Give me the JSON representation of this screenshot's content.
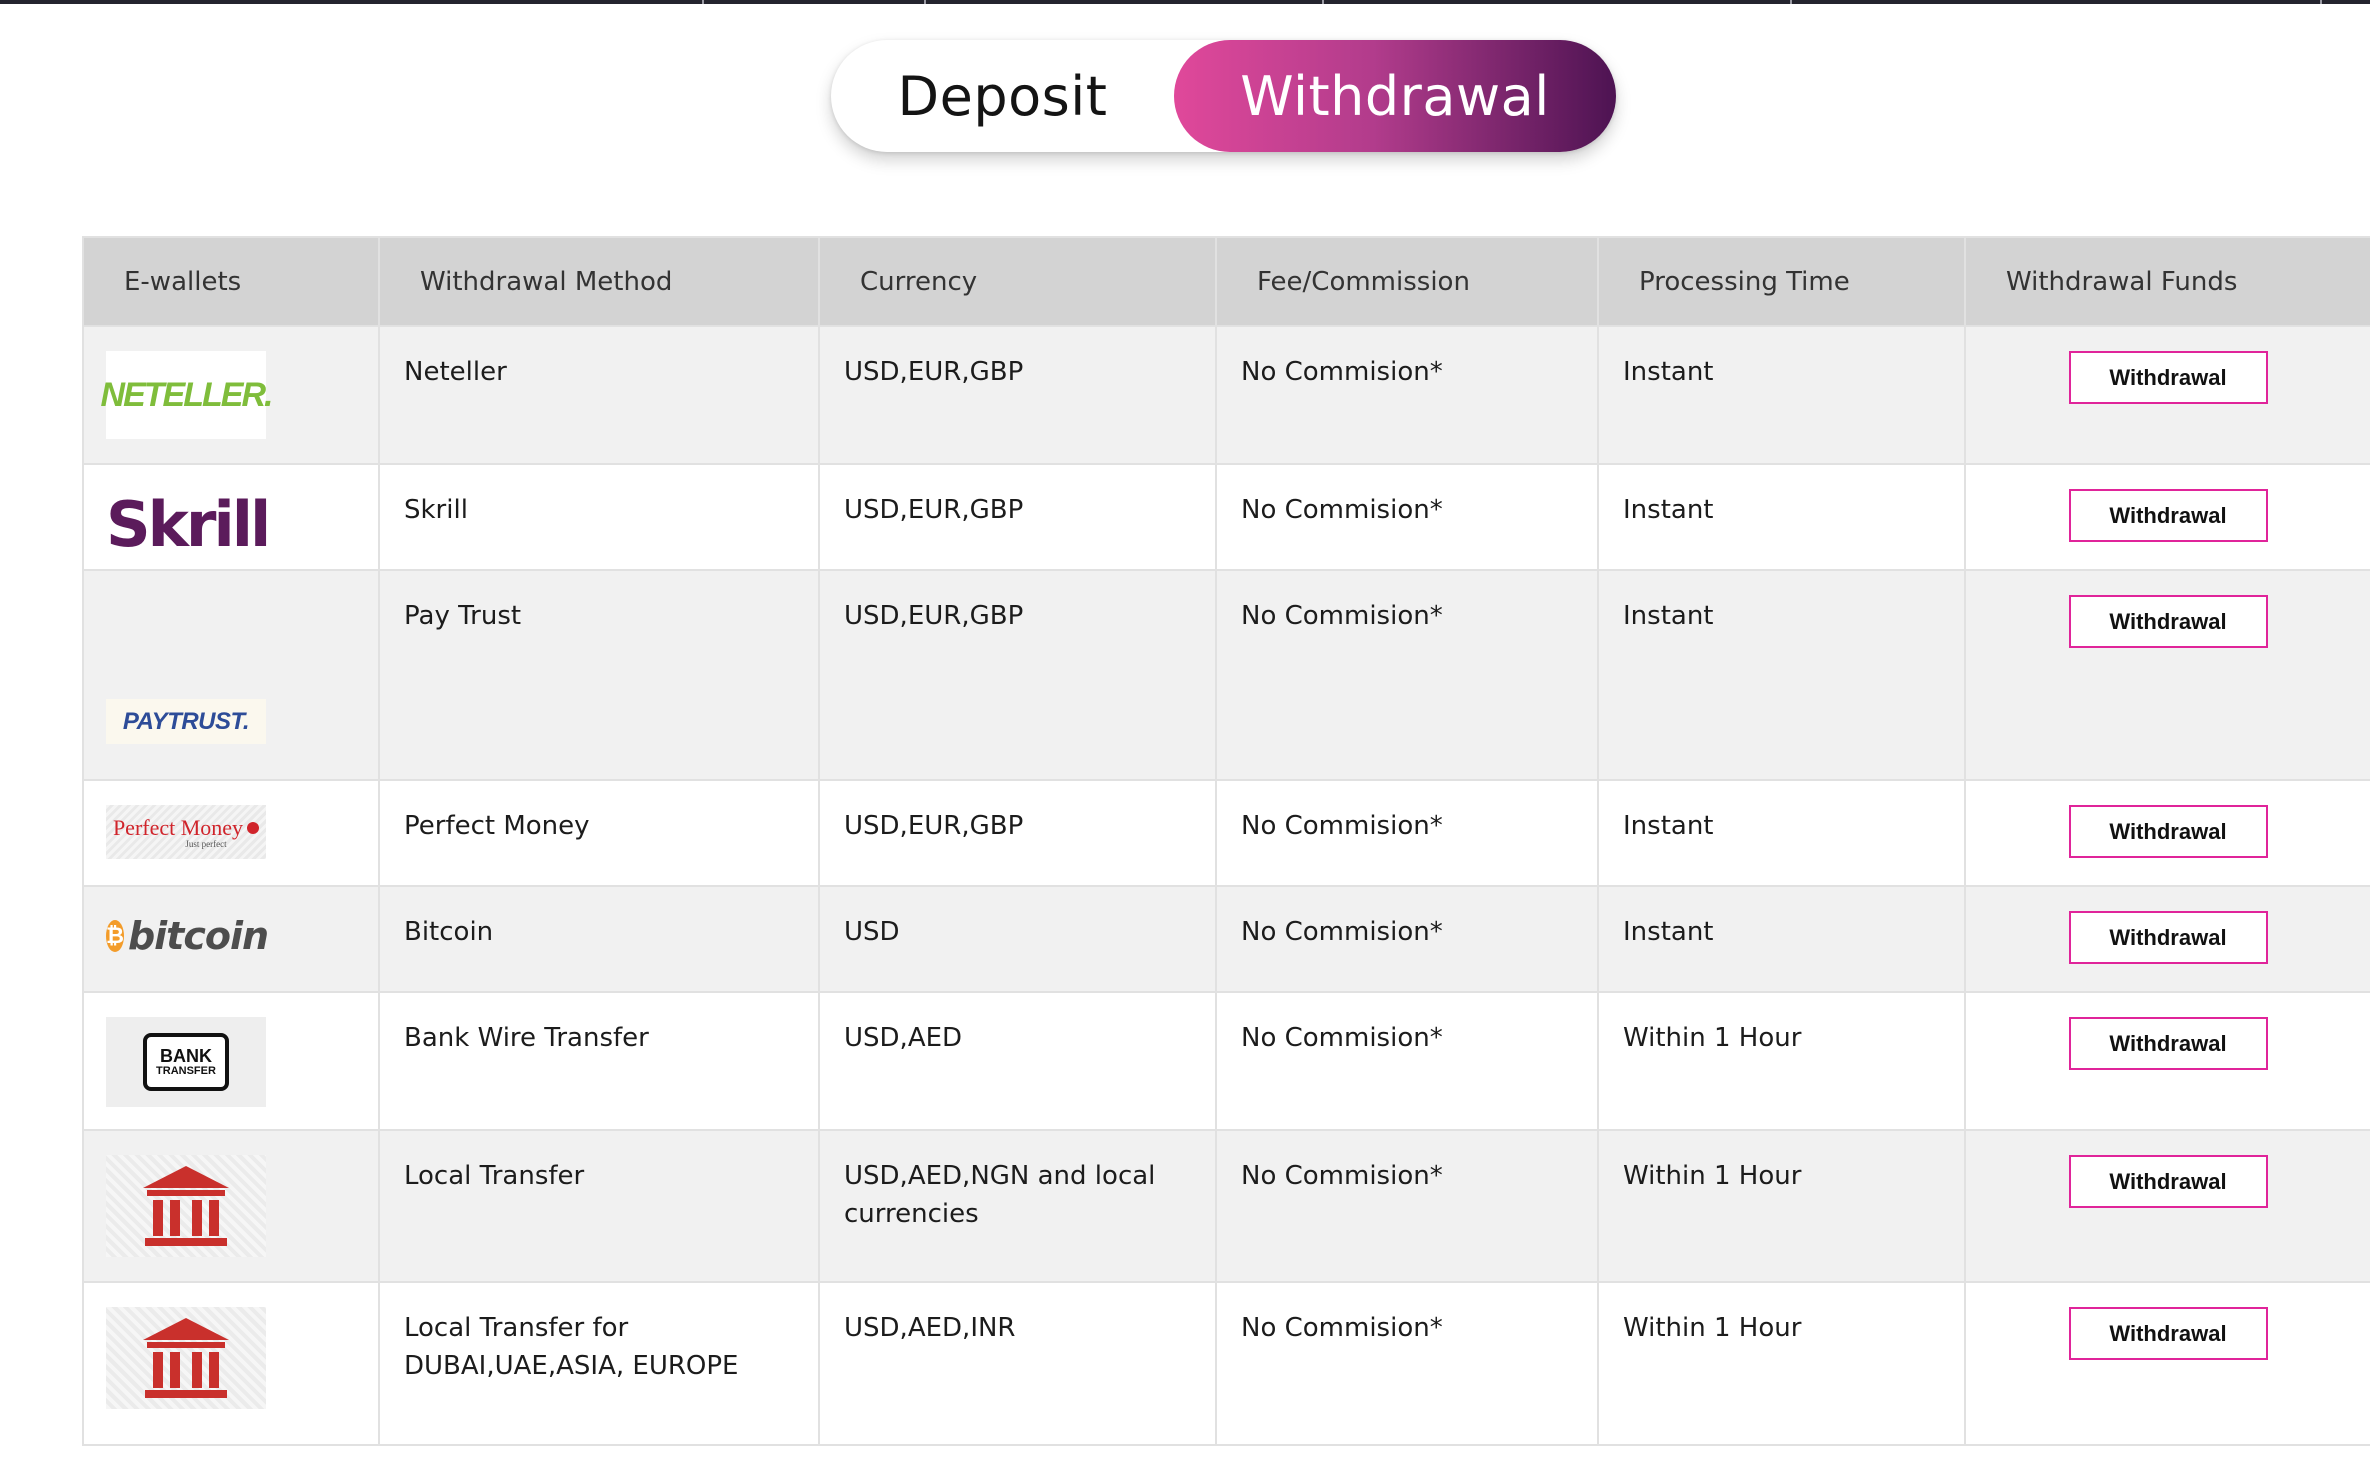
{
  "toggle": {
    "deposit_label": "Deposit",
    "withdrawal_label": "Withdrawal",
    "active": "Withdrawal"
  },
  "colors": {
    "accent_pink": "#e0249a",
    "gradient_start": "#e0489a",
    "gradient_end": "#4d1352",
    "header_bg": "#d3d3d3",
    "row_alt_bg": "#f1f1f1"
  },
  "table": {
    "headers": [
      "E-wallets",
      "Withdrawal Method",
      "Currency",
      "Fee/Commission",
      "Processing Time",
      "Withdrawal Funds"
    ],
    "rows": [
      {
        "logo_icon": "neteller-logo",
        "logo_text": "NETELLER.",
        "method": "Neteller",
        "currency": "USD,EUR,GBP",
        "fee": "No Commision*",
        "time": "Instant",
        "action": "Withdrawal"
      },
      {
        "logo_icon": "skrill-logo",
        "logo_text": "Skrill",
        "method": "Skrill",
        "currency": "USD,EUR,GBP",
        "fee": "No Commision*",
        "time": "Instant",
        "action": "Withdrawal"
      },
      {
        "logo_icon": "paytrust-logo",
        "logo_text": "PAYTRUST.",
        "method": "Pay Trust",
        "currency": "USD,EUR,GBP",
        "fee": "No Commision*",
        "time": "Instant",
        "action": "Withdrawal"
      },
      {
        "logo_icon": "perfect-money-logo",
        "logo_text": "Perfect Money",
        "logo_subtext": "Just perfect",
        "method": "Perfect Money",
        "currency": "USD,EUR,GBP",
        "fee": "No Commision*",
        "time": "Instant",
        "action": "Withdrawal"
      },
      {
        "logo_icon": "bitcoin-logo",
        "logo_text": "bitcoin",
        "method": "Bitcoin",
        "currency": "USD",
        "fee": "No Commision*",
        "time": "Instant",
        "action": "Withdrawal"
      },
      {
        "logo_icon": "bank-transfer-logo",
        "logo_text": "BANK",
        "logo_subtext": "TRANSFER",
        "method": "Bank Wire Transfer",
        "currency": "USD,AED",
        "fee": "No Commision*",
        "time": "Within 1 Hour",
        "action": "Withdrawal"
      },
      {
        "logo_icon": "bank-building-icon",
        "method": "Local Transfer",
        "currency": "USD,AED,NGN and local currencies",
        "fee": "No Commision*",
        "time": "Within 1 Hour",
        "action": "Withdrawal"
      },
      {
        "logo_icon": "bank-building-icon",
        "method": "Local Transfer for DUBAI,UAE,ASIA, EUROPE",
        "currency": "USD,AED,INR",
        "fee": "No Commision*",
        "time": "Within 1 Hour",
        "action": "Withdrawal"
      }
    ]
  }
}
